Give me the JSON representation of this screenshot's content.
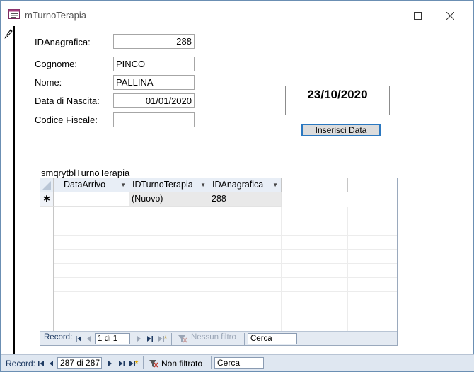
{
  "window": {
    "title": "mTurnoTerapia"
  },
  "form": {
    "id_label": "IDAnagrafica:",
    "id_value": "288",
    "cognome_label": "Cognome:",
    "cognome_value": "PINCO",
    "nome_label": "Nome:",
    "nome_value": "PALLINA",
    "nascita_label": "Data di Nascita:",
    "nascita_value": "01/01/2020",
    "cf_label": "Codice Fiscale:",
    "cf_value": "",
    "current_date": "23/10/2020",
    "insert_button": "Inserisci Data"
  },
  "subform": {
    "label": "smqrytblTurnoTerapia",
    "columns": [
      "DataArrivo",
      "IDTurnoTerapia",
      "IDAnagrafica"
    ],
    "new_row": {
      "marker": "✱",
      "cells": [
        "",
        "(Nuovo)",
        "288"
      ]
    },
    "nav": {
      "record_label": "Record:",
      "position": "1 di 1",
      "filter": "Nessun filtro",
      "search": "Cerca"
    }
  },
  "bottom_nav": {
    "record_label": "Record:",
    "position": "287 di 287",
    "filter": "Non filtrato",
    "search": "Cerca"
  },
  "colors": {
    "accent": "#2b78c0",
    "nav_bg": "#dfe7f1",
    "filter_icon_red": "#c0392b"
  },
  "icons": {
    "title": "form-icon",
    "pencil": "pencil-edit-icon",
    "first": "first-record-icon",
    "prev": "previous-record-icon",
    "next": "next-record-icon",
    "last": "last-record-icon",
    "new": "new-record-icon",
    "filter": "filter-off-icon"
  }
}
